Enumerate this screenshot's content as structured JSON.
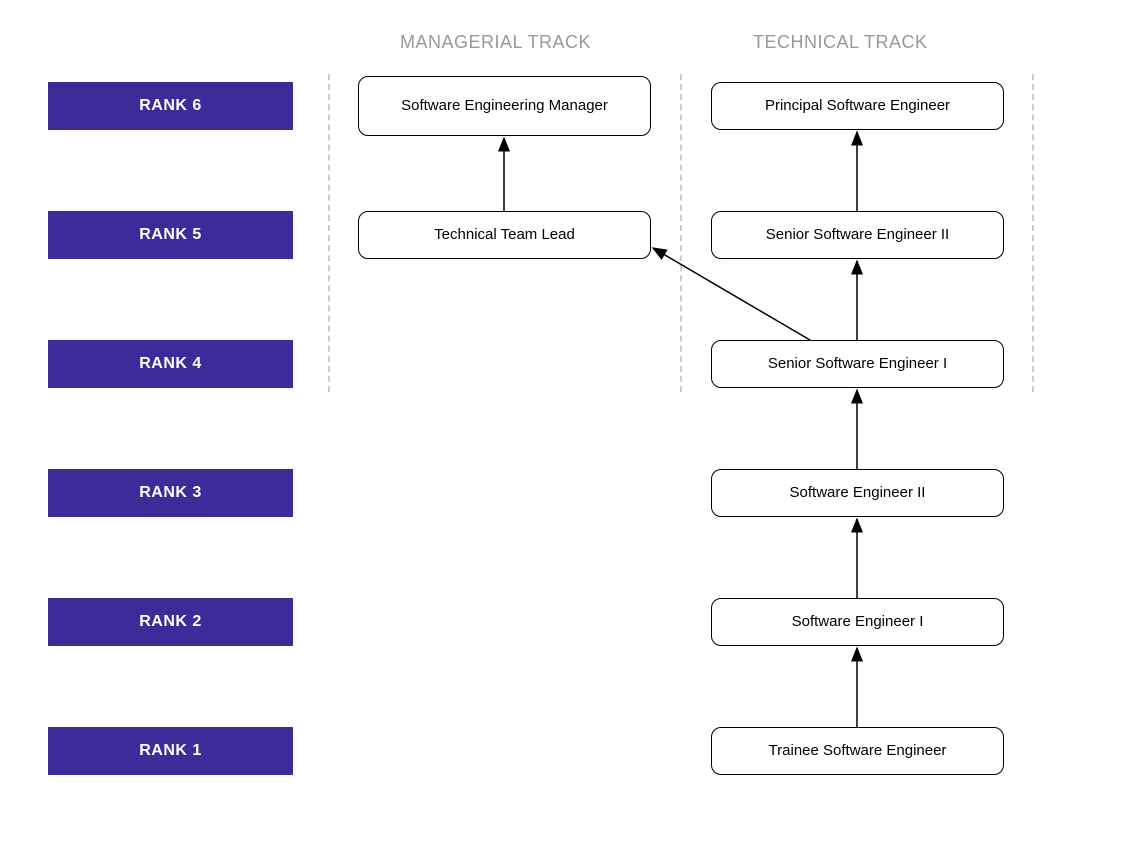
{
  "headers": {
    "managerial": "MANAGERIAL TRACK",
    "technical": "TECHNICAL TRACK"
  },
  "ranks": {
    "r6": "RANK 6",
    "r5": "RANK 5",
    "r4": "RANK 4",
    "r3": "RANK 3",
    "r2": "RANK 2",
    "r1": "RANK 1"
  },
  "roles": {
    "mgr6": "Software Engineering Manager",
    "mgr5": "Technical Team Lead",
    "tech6": "Principal Software Engineer",
    "tech5": "Senior Software Engineer II",
    "tech4": "Senior Software Engineer I",
    "tech3": "Software Engineer II",
    "tech2": "Software Engineer I",
    "tech1": "Trainee Software Engineer"
  },
  "colors": {
    "rank_bg": "#3e2a98",
    "rank_text": "#ffffff",
    "header_text": "#999999",
    "box_border": "#000000",
    "divider": "#cccccc"
  },
  "chart_data": {
    "type": "diagram",
    "title": "",
    "tracks": [
      {
        "name": "MANAGERIAL TRACK",
        "roles": [
          {
            "rank": 5,
            "title": "Technical Team Lead"
          },
          {
            "rank": 6,
            "title": "Software Engineering Manager"
          }
        ]
      },
      {
        "name": "TECHNICAL TRACK",
        "roles": [
          {
            "rank": 1,
            "title": "Trainee Software Engineer"
          },
          {
            "rank": 2,
            "title": "Software Engineer I"
          },
          {
            "rank": 3,
            "title": "Software Engineer II"
          },
          {
            "rank": 4,
            "title": "Senior Software Engineer I"
          },
          {
            "rank": 5,
            "title": "Senior Software Engineer II"
          },
          {
            "rank": 6,
            "title": "Principal Software Engineer"
          }
        ]
      }
    ],
    "edges": [
      {
        "from": "Trainee Software Engineer",
        "to": "Software Engineer I"
      },
      {
        "from": "Software Engineer I",
        "to": "Software Engineer II"
      },
      {
        "from": "Software Engineer II",
        "to": "Senior Software Engineer I"
      },
      {
        "from": "Senior Software Engineer I",
        "to": "Senior Software Engineer II"
      },
      {
        "from": "Senior Software Engineer II",
        "to": "Principal Software Engineer"
      },
      {
        "from": "Technical Team Lead",
        "to": "Software Engineering Manager"
      },
      {
        "from": "Senior Software Engineer I",
        "to": "Technical Team Lead"
      }
    ]
  }
}
